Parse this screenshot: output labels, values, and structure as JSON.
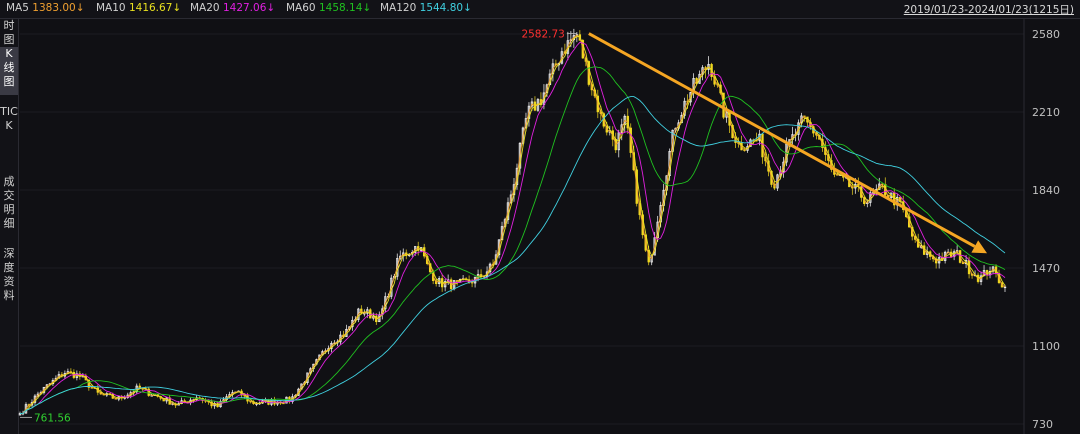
{
  "ma_legend": [
    {
      "label": "MA5",
      "value": "1383.00↓",
      "color": "#f0a030"
    },
    {
      "label": "MA10",
      "value": "1416.67↓",
      "color": "#e8e020"
    },
    {
      "label": "MA20",
      "value": "1427.06↓",
      "color": "#e020e0"
    },
    {
      "label": "MA60",
      "value": "1458.14↓",
      "color": "#20c020"
    },
    {
      "label": "MA120",
      "value": "1544.80↓",
      "color": "#40d0e0"
    }
  ],
  "date_range": "2019/01/23-2024/01/23(1215日)",
  "side_tabs": [
    {
      "label": "时图"
    },
    {
      "label": "K线图"
    },
    {
      "label": "TICK"
    },
    {
      "label": "成交明细"
    },
    {
      "label": "深度资料"
    }
  ],
  "colors": {
    "up": "#ffffff",
    "down": "#f0d820",
    "ma5": "#f0a030",
    "ma10": "#e8e020",
    "ma20": "#e020e0",
    "ma60": "#20c020",
    "ma120": "#40d0e0",
    "trend_arrow": "#f5a623",
    "max_label": "#ff3030",
    "min_label": "#30d030"
  },
  "chart_data": {
    "type": "candlestick",
    "title": "",
    "x_range": [
      "2019/01/23",
      "2024/01/23"
    ],
    "bar_count": 1215,
    "y_range": [
      730,
      2580
    ],
    "y_ticks": [
      "2580",
      "2210",
      "1840",
      "1470",
      "1100",
      "730"
    ],
    "annotations": {
      "max": "2582.73",
      "min": "761.56"
    },
    "approx_close_path": [
      {
        "t": 0.0,
        "v": 780
      },
      {
        "t": 0.02,
        "v": 880
      },
      {
        "t": 0.045,
        "v": 975
      },
      {
        "t": 0.06,
        "v": 960
      },
      {
        "t": 0.08,
        "v": 870
      },
      {
        "t": 0.1,
        "v": 850
      },
      {
        "t": 0.12,
        "v": 900
      },
      {
        "t": 0.14,
        "v": 860
      },
      {
        "t": 0.16,
        "v": 820
      },
      {
        "t": 0.18,
        "v": 860
      },
      {
        "t": 0.2,
        "v": 810
      },
      {
        "t": 0.215,
        "v": 880
      },
      {
        "t": 0.225,
        "v": 870
      },
      {
        "t": 0.235,
        "v": 830
      },
      {
        "t": 0.255,
        "v": 835
      },
      {
        "t": 0.275,
        "v": 845
      },
      {
        "t": 0.295,
        "v": 980
      },
      {
        "t": 0.315,
        "v": 1120
      },
      {
        "t": 0.33,
        "v": 1160
      },
      {
        "t": 0.345,
        "v": 1270
      },
      {
        "t": 0.365,
        "v": 1230
      },
      {
        "t": 0.385,
        "v": 1520
      },
      {
        "t": 0.405,
        "v": 1580
      },
      {
        "t": 0.415,
        "v": 1460
      },
      {
        "t": 0.425,
        "v": 1400
      },
      {
        "t": 0.445,
        "v": 1390
      },
      {
        "t": 0.465,
        "v": 1420
      },
      {
        "t": 0.48,
        "v": 1480
      },
      {
        "t": 0.5,
        "v": 1850
      },
      {
        "t": 0.515,
        "v": 2200
      },
      {
        "t": 0.53,
        "v": 2280
      },
      {
        "t": 0.55,
        "v": 2500
      },
      {
        "t": 0.565,
        "v": 2582
      },
      {
        "t": 0.575,
        "v": 2420
      },
      {
        "t": 0.59,
        "v": 2180
      },
      {
        "t": 0.605,
        "v": 2060
      },
      {
        "t": 0.615,
        "v": 2170
      },
      {
        "t": 0.63,
        "v": 1680
      },
      {
        "t": 0.638,
        "v": 1470
      },
      {
        "t": 0.65,
        "v": 1780
      },
      {
        "t": 0.665,
        "v": 2150
      },
      {
        "t": 0.68,
        "v": 2300
      },
      {
        "t": 0.7,
        "v": 2450
      },
      {
        "t": 0.715,
        "v": 2200
      },
      {
        "t": 0.73,
        "v": 2050
      },
      {
        "t": 0.75,
        "v": 2080
      },
      {
        "t": 0.765,
        "v": 1870
      },
      {
        "t": 0.78,
        "v": 2050
      },
      {
        "t": 0.795,
        "v": 2170
      },
      {
        "t": 0.81,
        "v": 2100
      },
      {
        "t": 0.825,
        "v": 1910
      },
      {
        "t": 0.845,
        "v": 1850
      },
      {
        "t": 0.86,
        "v": 1790
      },
      {
        "t": 0.875,
        "v": 1850
      },
      {
        "t": 0.895,
        "v": 1760
      },
      {
        "t": 0.91,
        "v": 1570
      },
      {
        "t": 0.93,
        "v": 1510
      },
      {
        "t": 0.95,
        "v": 1540
      },
      {
        "t": 0.965,
        "v": 1460
      },
      {
        "t": 0.975,
        "v": 1420
      },
      {
        "t": 0.985,
        "v": 1470
      },
      {
        "t": 1.0,
        "v": 1380
      }
    ]
  }
}
